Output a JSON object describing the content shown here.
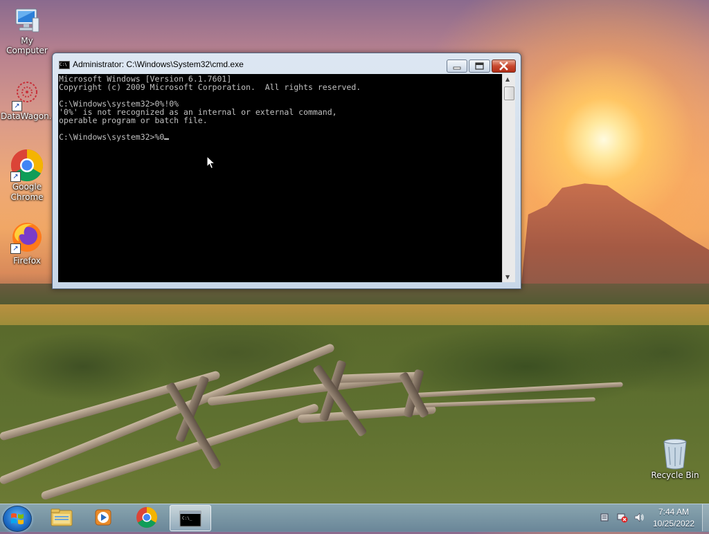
{
  "desktop": {
    "icons": [
      {
        "label": "My Computer",
        "icon": "computer-icon"
      },
      {
        "label": "DataWagon...",
        "icon": "datawagon-icon"
      },
      {
        "label": "Google Chrome",
        "icon": "chrome-icon"
      },
      {
        "label": "Firefox",
        "icon": "firefox-icon"
      },
      {
        "label": "Recycle Bin",
        "icon": "recycle-bin-icon"
      }
    ]
  },
  "window": {
    "title": "Administrator: C:\\Windows\\System32\\cmd.exe",
    "console_lines": [
      "Microsoft Windows [Version 6.1.7601]",
      "Copyright (c) 2009 Microsoft Corporation.  All rights reserved.",
      "",
      "C:\\Windows\\system32>0%!0%",
      "'0%' is not recognized as an internal or external command,",
      "operable program or batch file.",
      "",
      "C:\\Windows\\system32>%0"
    ]
  },
  "taskbar": {
    "items": [
      "start-orb",
      "explorer-icon",
      "media-player-icon",
      "chrome-icon",
      "cmd-icon"
    ],
    "active": "cmd-icon"
  },
  "clock": {
    "time": "7:44 AM",
    "date": "10/25/2022"
  },
  "colors": {
    "console_bg": "#000000",
    "console_fg": "#c0c0c0",
    "close_button": "#c8482e"
  }
}
